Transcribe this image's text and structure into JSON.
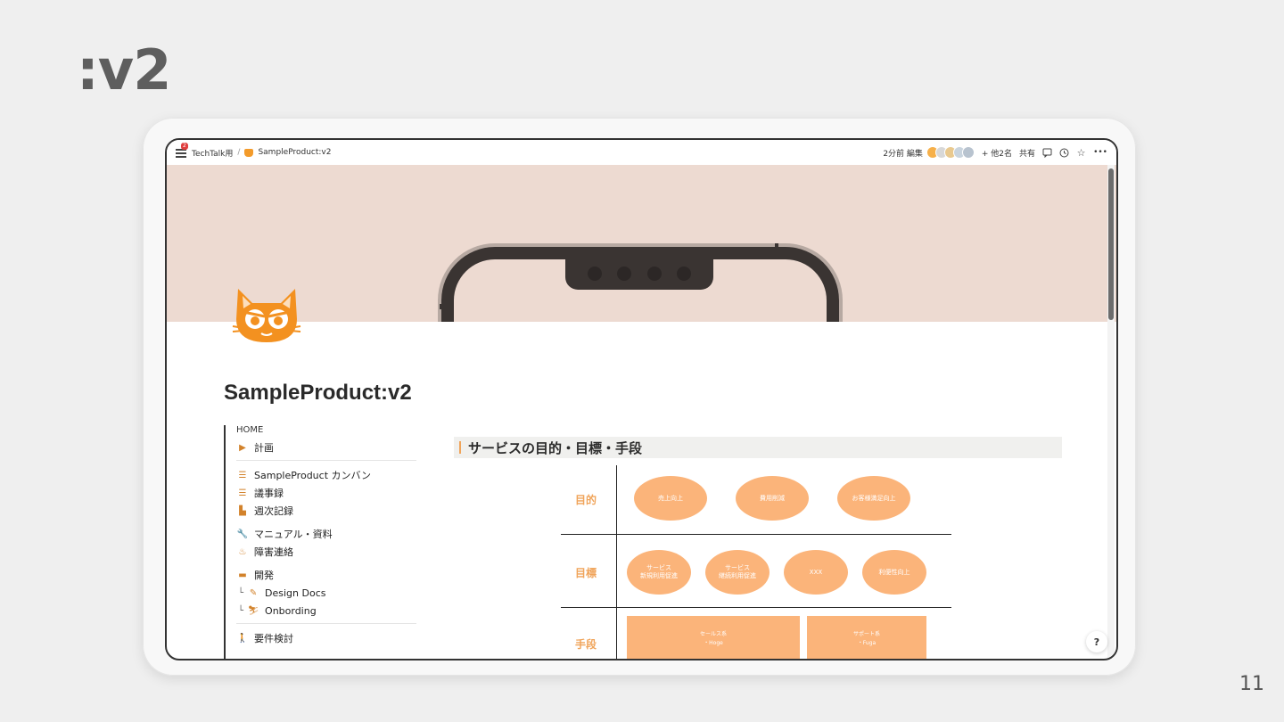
{
  "slide": {
    "title": ":v2",
    "page_number": "11"
  },
  "topbar": {
    "badge": "2",
    "workspace": "TechTalk用",
    "separator": "/",
    "page": "SampleProduct:v2",
    "edited": "2分前 編集",
    "others": "+ 他2名",
    "share": "共有",
    "more": "•••"
  },
  "page": {
    "title": "SampleProduct:v2"
  },
  "sidebar": {
    "home": "HOME",
    "items": [
      {
        "label": "計画",
        "icon": "flag-icon"
      },
      {
        "label": "SampleProduct カンバン",
        "icon": "list-icon"
      },
      {
        "label": "議事録",
        "icon": "list-icon"
      },
      {
        "label": "週次記録",
        "icon": "bar-chart-icon"
      },
      {
        "label": "マニュアル・資料",
        "icon": "wrench-icon"
      },
      {
        "label": "障害連絡",
        "icon": "flame-icon"
      },
      {
        "label": "開発",
        "icon": "laptop-icon"
      },
      {
        "label": "Design Docs",
        "icon": "pencil-icon",
        "prefix": "└"
      },
      {
        "label": "Onbording",
        "icon": "ski-icon",
        "prefix": "└"
      },
      {
        "label": "要件検討",
        "icon": "walking-icon"
      }
    ]
  },
  "section": {
    "heading": "サービスの目的・目標・手段"
  },
  "diagram": {
    "rows": [
      "目的",
      "目標",
      "手段"
    ],
    "goals": [
      "売上向上",
      "費用削減",
      "お客様満足向上"
    ],
    "targets": [
      "サービス\n新規利用促進",
      "サービス\n継続利用促進",
      "XXX",
      "利便性向上"
    ],
    "means": [
      {
        "title": "セールス系",
        "sub": "・Hoge"
      },
      {
        "title": "サポート系",
        "sub": "・Fuga"
      }
    ]
  },
  "help": {
    "label": "?"
  },
  "colors": {
    "accent": "#f0a45a",
    "shape_fill": "#fbb47a",
    "cover": "#eddad1"
  }
}
